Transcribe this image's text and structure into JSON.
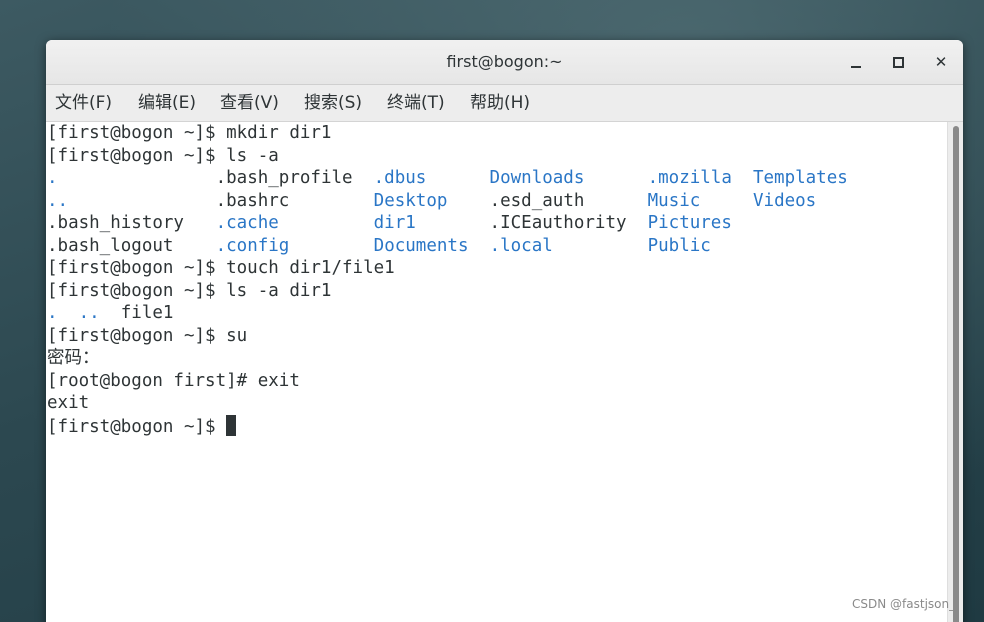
{
  "window": {
    "title": "first@bogon:~",
    "minimize_icon": "minimize-icon",
    "maximize_icon": "maximize-icon",
    "close_icon": "close-icon",
    "close_glyph": "✕"
  },
  "menu": {
    "items": [
      {
        "label": "文件(F)"
      },
      {
        "label": "编辑(E)"
      },
      {
        "label": "查看(V)"
      },
      {
        "label": "搜索(S)"
      },
      {
        "label": "终端(T)"
      },
      {
        "label": "帮助(H)"
      }
    ]
  },
  "colors": {
    "text": "#2e3436",
    "directory": "#2a76c6",
    "background": "#ffffff"
  },
  "terminal": {
    "lines": [
      {
        "segments": [
          {
            "text": "[first@bogon ~]$ mkdir dir1"
          }
        ]
      },
      {
        "segments": [
          {
            "text": "[first@bogon ~]$ ls -a"
          }
        ]
      },
      {
        "segments": [
          {
            "text": ".",
            "color": "blue"
          },
          {
            "text": "               "
          },
          {
            "text": ".bash_profile"
          },
          {
            "text": "  "
          },
          {
            "text": ".dbus",
            "color": "blue"
          },
          {
            "text": "      "
          },
          {
            "text": "Downloads",
            "color": "blue"
          },
          {
            "text": "      "
          },
          {
            "text": ".mozilla",
            "color": "blue"
          },
          {
            "text": "  "
          },
          {
            "text": "Templates",
            "color": "blue"
          }
        ]
      },
      {
        "segments": [
          {
            "text": "..",
            "color": "blue"
          },
          {
            "text": "              "
          },
          {
            "text": ".bashrc"
          },
          {
            "text": "        "
          },
          {
            "text": "Desktop",
            "color": "blue"
          },
          {
            "text": "    "
          },
          {
            "text": ".esd_auth"
          },
          {
            "text": "      "
          },
          {
            "text": "Music",
            "color": "blue"
          },
          {
            "text": "     "
          },
          {
            "text": "Videos",
            "color": "blue"
          }
        ]
      },
      {
        "segments": [
          {
            "text": ".bash_history"
          },
          {
            "text": "   "
          },
          {
            "text": ".cache",
            "color": "blue"
          },
          {
            "text": "         "
          },
          {
            "text": "dir1",
            "color": "blue"
          },
          {
            "text": "       "
          },
          {
            "text": ".ICEauthority"
          },
          {
            "text": "  "
          },
          {
            "text": "Pictures",
            "color": "blue"
          }
        ]
      },
      {
        "segments": [
          {
            "text": ".bash_logout"
          },
          {
            "text": "    "
          },
          {
            "text": ".config",
            "color": "blue"
          },
          {
            "text": "        "
          },
          {
            "text": "Documents",
            "color": "blue"
          },
          {
            "text": "  "
          },
          {
            "text": ".local",
            "color": "blue"
          },
          {
            "text": "         "
          },
          {
            "text": "Public",
            "color": "blue"
          }
        ]
      },
      {
        "segments": [
          {
            "text": "[first@bogon ~]$ touch dir1/file1"
          }
        ]
      },
      {
        "segments": [
          {
            "text": "[first@bogon ~]$ ls -a dir1"
          }
        ]
      },
      {
        "segments": [
          {
            "text": ".",
            "color": "blue"
          },
          {
            "text": "  "
          },
          {
            "text": "..",
            "color": "blue"
          },
          {
            "text": "  file1"
          }
        ]
      },
      {
        "segments": [
          {
            "text": "[first@bogon ~]$ su"
          }
        ]
      },
      {
        "segments": [
          {
            "text": "密码："
          }
        ]
      },
      {
        "segments": [
          {
            "text": "[root@bogon first]# exit"
          }
        ]
      },
      {
        "segments": [
          {
            "text": "exit"
          }
        ]
      },
      {
        "segments": [
          {
            "text": "[first@bogon ~]$ "
          }
        ],
        "cursor": true
      }
    ]
  },
  "watermark": "CSDN @fastjson_"
}
